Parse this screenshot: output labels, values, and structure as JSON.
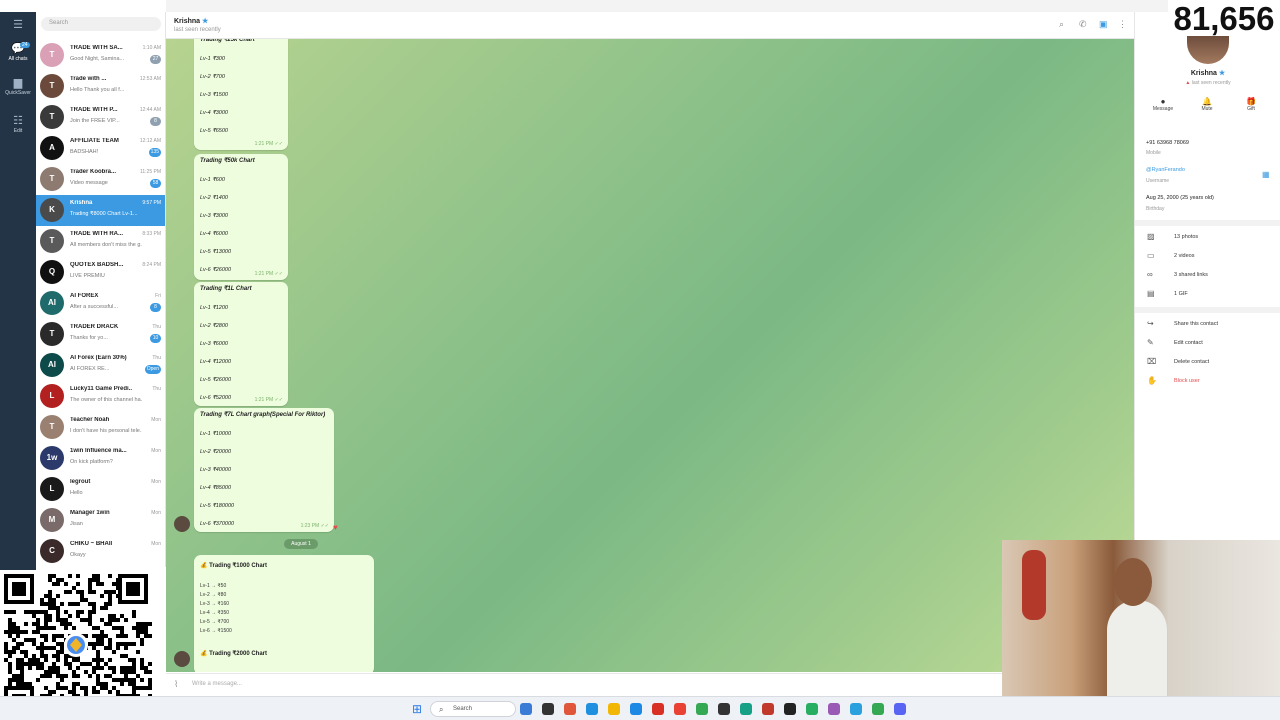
{
  "counter": "81,656",
  "rail": [
    {
      "label": "All chats",
      "badge": "24",
      "icon": "chat-bubbles-icon",
      "active": true
    },
    {
      "label": "QuickSaver",
      "icon": "folder-icon",
      "active": false
    },
    {
      "label": "Edit",
      "icon": "sliders-icon",
      "active": false
    }
  ],
  "search": {
    "placeholder": "Search"
  },
  "chats": [
    {
      "name": "TRADE WITH SA...",
      "time": "1:10 AM",
      "preview": "Good Night, Samina...",
      "badge": "27",
      "badge_blue": false,
      "color": "#d9a0b6",
      "initial": "T"
    },
    {
      "name": "Trade with ...",
      "time": "12:53 AM",
      "preview": "Hello Thank you all f...",
      "badge": "",
      "badge_blue": false,
      "color": "#6b4a3b",
      "initial": "T"
    },
    {
      "name": "TRADE WITH P...",
      "time": "12:44 AM",
      "preview": "Join the FREE VIP...",
      "badge": "8",
      "badge_blue": false,
      "color": "#3a3a3a",
      "initial": "T"
    },
    {
      "name": "AFFILIATE TEAM",
      "time": "12:12 AM",
      "preview": "BADSHAH!",
      "badge": "135",
      "badge_blue": true,
      "color": "#111111",
      "initial": "A"
    },
    {
      "name": "Trader Koobra...",
      "time": "11:25 PM",
      "preview": "Video message",
      "badge": "58",
      "badge_blue": true,
      "color": "#8d7a70",
      "initial": "T"
    },
    {
      "name": "Krishna",
      "time": "9:57 PM",
      "preview": "Trading ₹8000 Chart Lv-1...",
      "badge": "",
      "badge_blue": false,
      "color": "#4a4a4a",
      "initial": "K"
    },
    {
      "name": "TRADE WITH RA...",
      "time": "8:33 PM",
      "preview": "All members don't miss the g...",
      "badge": "",
      "badge_blue": false,
      "color": "#5a5a5a",
      "initial": "T"
    },
    {
      "name": "QUOTEX BADSH...",
      "time": "8:24 PM",
      "preview": "LIVE  PREMIU",
      "badge": "",
      "badge_blue": false,
      "color": "#101010",
      "initial": "Q"
    },
    {
      "name": "AI FOREX",
      "time": "Fri",
      "preview": "After a successful...",
      "badge": "8",
      "badge_blue": true,
      "color": "#1f6b6b",
      "initial": "AI"
    },
    {
      "name": "TRADER DRACK",
      "time": "Thu",
      "preview": "Thanks for yo...",
      "badge": "10",
      "badge_blue": true,
      "color": "#2a2a2a",
      "initial": "T"
    },
    {
      "name": "AI Forex (Earn 30%)",
      "time": "Thu",
      "preview": "AI FOREX RE...",
      "badge": "Open",
      "badge_blue": true,
      "color": "#0d4a4a",
      "initial": "AI"
    },
    {
      "name": "Lucky11 Game Predi...",
      "time": "Thu",
      "preview": "The owner of this channel ha...",
      "badge": "",
      "badge_blue": false,
      "color": "#b32020",
      "initial": "L"
    },
    {
      "name": "Teacher Noah",
      "time": "Mon",
      "preview": "I don't have his personal tele...",
      "badge": "",
      "badge_blue": false,
      "color": "#9a8070",
      "initial": "T"
    },
    {
      "name": "1win Influence ma...",
      "time": "Mon",
      "preview": "On kick platform?",
      "badge": "",
      "badge_blue": false,
      "color": "#2b3a6a",
      "initial": "1w"
    },
    {
      "name": "legrout",
      "time": "Mon",
      "preview": "Hello",
      "badge": "",
      "badge_blue": false,
      "color": "#1a1a1a",
      "initial": "L"
    },
    {
      "name": "Manager 1win",
      "time": "Mon",
      "preview": "Jisan",
      "badge": "",
      "badge_blue": false,
      "color": "#7a6a6a",
      "initial": "M"
    },
    {
      "name": "CHIKU ~ BHAII",
      "time": "Mon",
      "preview": "Okayy",
      "badge": "",
      "badge_blue": false,
      "color": "#3a2a2a",
      "initial": "C"
    }
  ],
  "header": {
    "name": "Krishna",
    "status": "last seen recently"
  },
  "messages": [
    {
      "title": "Trading ₹25k Chart",
      "levels": [
        "Lv-1  ₹300",
        "Lv-2  ₹700",
        "Lv-3  ₹1500",
        "Lv-4  ₹3000",
        "Lv-5  ₹6500",
        "Lv-6  ₹13000"
      ],
      "time": "1:21 PM"
    },
    {
      "title": "Trading ₹50k Chart",
      "levels": [
        "Lv-1  ₹600",
        "Lv-2  ₹1400",
        "Lv-3  ₹3000",
        "Lv-4  ₹6000",
        "Lv-5  ₹13000",
        "Lv-6  ₹26000"
      ],
      "time": "1:21 PM"
    },
    {
      "title": "Trading ₹1L Chart",
      "levels": [
        "Lv-1  ₹1200",
        "Lv-2  ₹2800",
        "Lv-3  ₹6000",
        "Lv-4  ₹12000",
        "Lv-5  ₹26000",
        "Lv-6  ₹52000"
      ],
      "time": "1:21 PM"
    },
    {
      "title": "Trading ₹7L Chart graph(Special For Riktor)",
      "levels": [
        "Lv-1  ₹10000",
        "Lv-2  ₹20000",
        "Lv-3  ₹40000",
        "Lv-4  ₹85000",
        "Lv-5  ₹180000",
        "Lv-6  ₹370000"
      ],
      "time": "1:23 PM"
    }
  ],
  "date_separator": "August 1",
  "small_message": {
    "title": "Trading ₹1000 Chart",
    "levels": [
      "Lv-1 → ₹50",
      "Lv-2 → ₹80",
      "Lv-3 → ₹160",
      "Lv-4 → ₹350",
      "Lv-5 → ₹700",
      "Lv-6 → ₹1500"
    ],
    "next_title": "Trading ₹2000 Chart"
  },
  "composer": {
    "placeholder": "Write a message..."
  },
  "profile": {
    "name": "Krishna",
    "status": "last seen recently",
    "actions": [
      "Message",
      "Mute",
      "Gift"
    ],
    "phone": "+91 63968 78069",
    "phone_label": "Mobile",
    "username": "@RyanFerando",
    "username_label": "Username",
    "birthday": "Aug 25, 2000 (25 years old)",
    "birthday_label": "Birthday",
    "media": [
      "13 photos",
      "2 videos",
      "3 shared links",
      "1 GIF"
    ],
    "contact_actions": [
      "Share this contact",
      "Edit contact",
      "Delete contact",
      "Block user"
    ]
  },
  "taskbar": {
    "search": "Search"
  },
  "colors": {
    "accent": "#3b9ae1",
    "rail": "#243447",
    "bubble": "#effddf",
    "danger": "#e04a4a"
  }
}
